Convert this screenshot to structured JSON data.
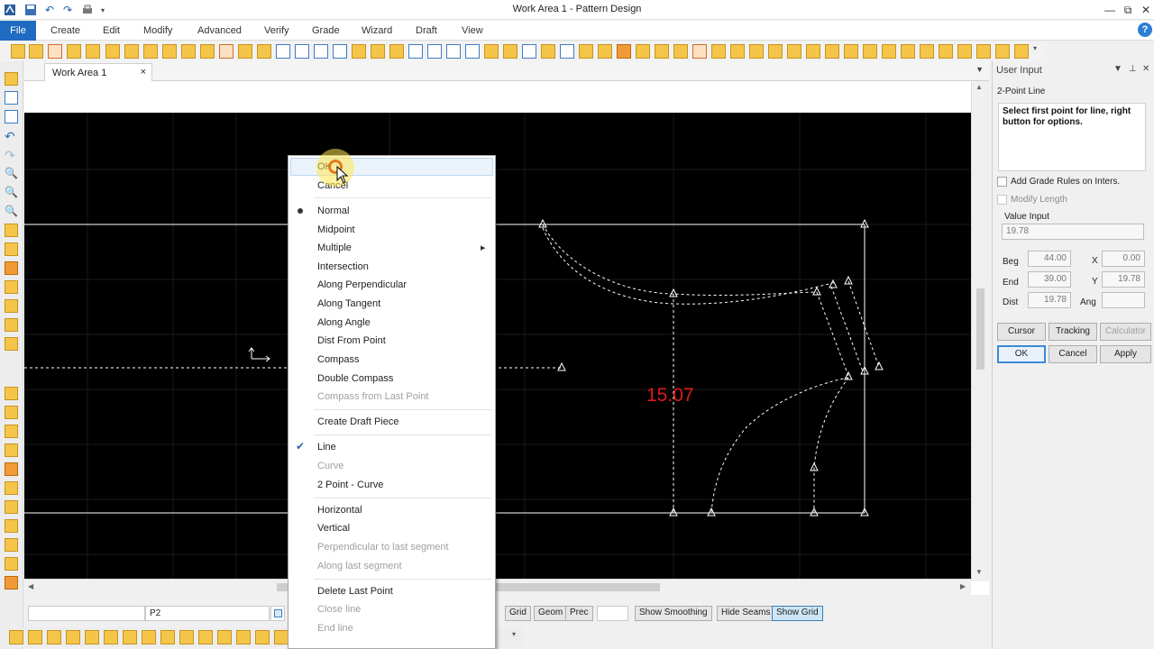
{
  "window": {
    "title": "Work Area 1 - Pattern Design",
    "controls": [
      "—",
      "⧉",
      "✕"
    ]
  },
  "menubar": {
    "items": [
      "File",
      "Create",
      "Edit",
      "Modify",
      "Advanced",
      "Verify",
      "Grade",
      "Wizard",
      "Draft",
      "View"
    ]
  },
  "tabs": {
    "active": "Work Area 1",
    "close_glyph": "×"
  },
  "canvas": {
    "measurement": "15.07",
    "measurement_color": "#e01818"
  },
  "status": {
    "point_name": "P2",
    "buttons": [
      "Grid",
      "Geom",
      "Prec",
      "Show Smoothing",
      "Hide Seams",
      "Show Grid"
    ],
    "active_button": "Show Grid"
  },
  "user_input": {
    "panel_title": "User Input",
    "tool_name": "2-Point Line",
    "prompt": "Select first point for line, right button for options.",
    "add_grade_rules_label": "Add Grade Rules on Inters.",
    "modify_length_label": "Modify Length",
    "value_input_label": "Value Input",
    "value_input": "19.78",
    "beg_label": "Beg",
    "beg_value": "44.00",
    "end_label": "End",
    "end_value": "39.00",
    "dist_label": "Dist",
    "dist_value": "19.78",
    "x_label": "X",
    "x_value": "0.00",
    "y_label": "Y",
    "y_value": "19.78",
    "ang_label": "Ang",
    "ang_value": "",
    "cursor_button": "Cursor",
    "tracking_button": "Tracking",
    "calculator_button": "Calculator",
    "ok_button": "OK",
    "cancel_button": "Cancel",
    "apply_button": "Apply"
  },
  "context_menu": {
    "ok": "OK",
    "cancel": "Cancel",
    "normal": "Normal",
    "midpoint": "Midpoint",
    "multiple": "Multiple",
    "intersection": "Intersection",
    "along_perpendicular": "Along Perpendicular",
    "along_tangent": "Along Tangent",
    "along_angle": "Along Angle",
    "dist_from_point": "Dist From Point",
    "compass": "Compass",
    "double_compass": "Double Compass",
    "compass_from_last_point": "Compass from Last Point",
    "create_draft_piece": "Create Draft Piece",
    "line": "Line",
    "curve": "Curve",
    "two_point_curve": "2 Point - Curve",
    "horizontal": "Horizontal",
    "vertical": "Vertical",
    "perpendicular_to_last_segment": "Perpendicular to last segment",
    "along_last_segment": "Along last segment",
    "delete_last_point": "Delete Last Point",
    "close_line": "Close line",
    "end_line": "End line"
  }
}
